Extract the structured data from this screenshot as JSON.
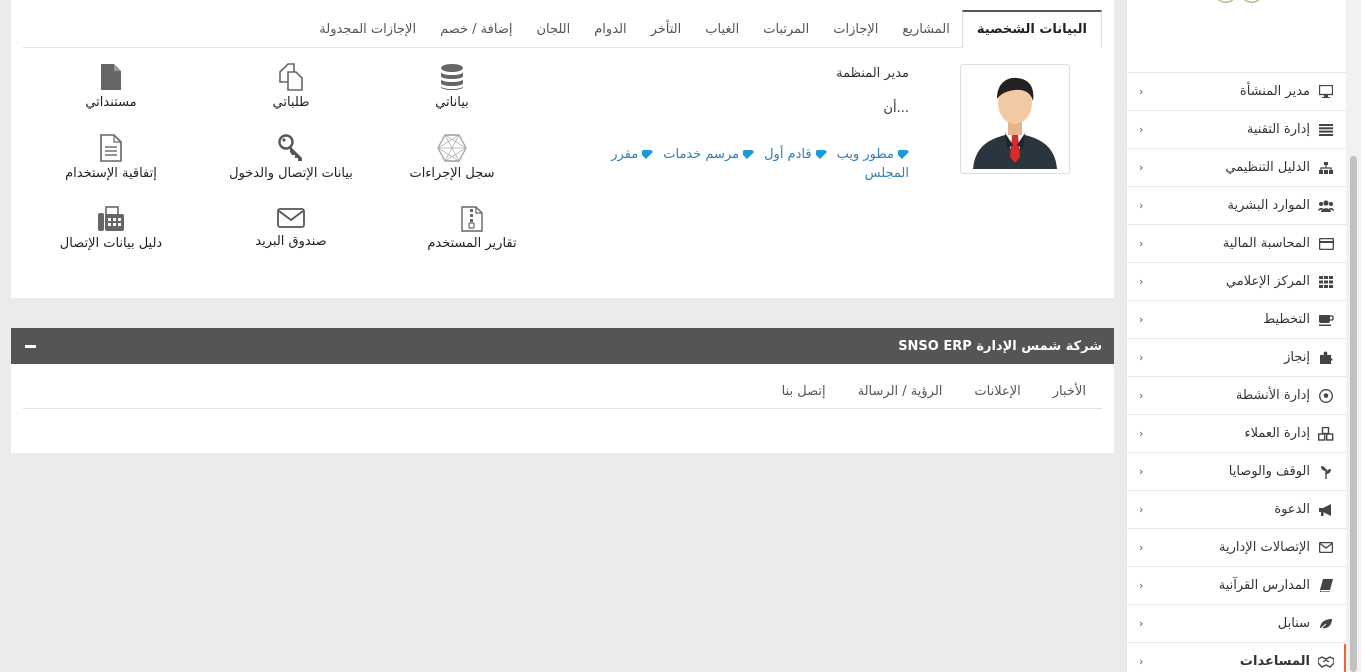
{
  "profile": {
    "tabs": [
      {
        "label": "البيانات الشخصية",
        "active": true
      },
      {
        "label": "المشاريع"
      },
      {
        "label": "الإجازات"
      },
      {
        "label": "المرتبات"
      },
      {
        "label": "الغياب"
      },
      {
        "label": "التأخر"
      },
      {
        "label": "الدوام"
      },
      {
        "label": "اللجان"
      },
      {
        "label": "إضافة / خصم"
      },
      {
        "label": "الإجازات المجدولة"
      }
    ],
    "role": "مدير المنظمة",
    "name": "أن...",
    "tags": [
      "مطور ويب",
      "قادم أول",
      "مرسم خدمات",
      "مقرر",
      "المجلس"
    ],
    "quick_links": {
      "my_data": "بياناتي",
      "my_requests": "طلباتي",
      "my_documents": "مستنداتي",
      "procedures_log": "سجل الإجراءات",
      "login_data": "بيانات الإتصال والدخول",
      "employment_agreement": "إتفاقية الإستخدام",
      "user_reports": "تقارير المستخدم",
      "mailbox": "صندوق البريد",
      "contact_directory": "دليل بيانات الإتصال"
    }
  },
  "company": {
    "title": "شركة شمس الإدارة SNSO ERP",
    "tabs": [
      "الأخبار",
      "الإعلانات",
      "الرؤية / الرسالة",
      "إتصل بنا"
    ]
  },
  "sidebar": {
    "items": [
      {
        "label": "مدير المنشأة",
        "icon": "monitor-icon"
      },
      {
        "label": "إدارة التقنية",
        "icon": "list-icon"
      },
      {
        "label": "الدليل التنظيمي",
        "icon": "sitemap-icon"
      },
      {
        "label": "الموارد البشرية",
        "icon": "users-icon"
      },
      {
        "label": "المحاسبة المالية",
        "icon": "credit-card-icon"
      },
      {
        "label": "المركز الإعلامي",
        "icon": "grid-icon"
      },
      {
        "label": "التخطيط",
        "icon": "coffee-icon"
      },
      {
        "label": "إنجاز",
        "icon": "puzzle-icon"
      },
      {
        "label": "إدارة الأنشطة",
        "icon": "soccer-icon"
      },
      {
        "label": "إدارة العملاء",
        "icon": "cubes-icon"
      },
      {
        "label": "الوقف والوصايا",
        "icon": "plant-icon"
      },
      {
        "label": "الدعوة",
        "icon": "megaphone-icon"
      },
      {
        "label": "الإتصالات الإدارية",
        "icon": "envelope-icon"
      },
      {
        "label": "المدارس القرآنية",
        "icon": "book-icon"
      },
      {
        "label": "سنابل",
        "icon": "leaf-icon"
      },
      {
        "label": "المساعدات",
        "icon": "handshake-icon",
        "active": true
      }
    ],
    "chevron": "›"
  },
  "colors": {
    "accent": "#e5673a",
    "link": "#2f7fb5",
    "tag": "#1a9ad6",
    "header_bar": "#555555"
  }
}
